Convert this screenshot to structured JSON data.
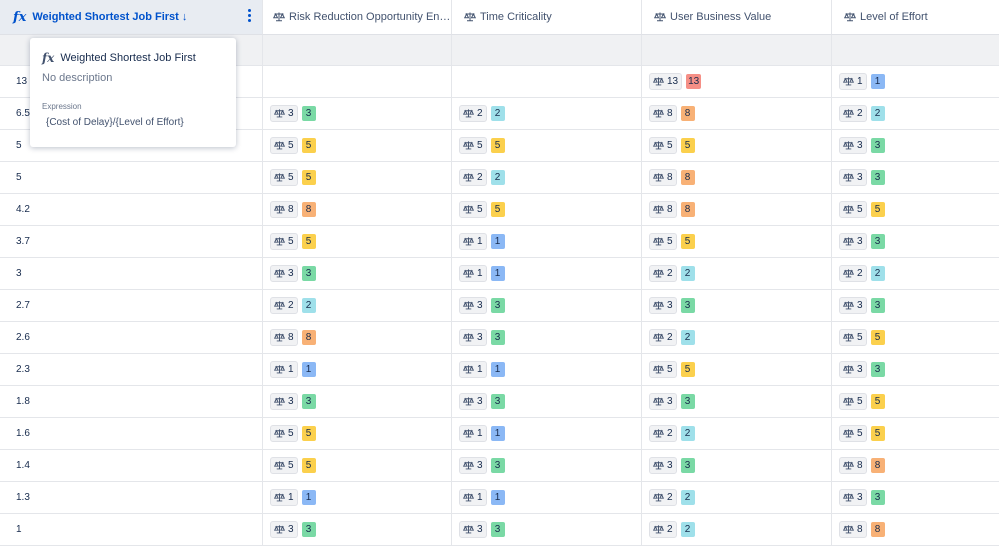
{
  "columns": [
    {
      "label": "Weighted Shortest Job First",
      "sort_icon": "↓"
    },
    {
      "label": "Risk Reduction Opportunity Enabl..."
    },
    {
      "label": "Time Criticality"
    },
    {
      "label": "User Business Value"
    },
    {
      "label": "Level of Effort"
    }
  ],
  "popover": {
    "title": "Weighted Shortest Job First",
    "description": "No description",
    "expression_label": "Expression",
    "expression": "{Cost of Delay}/{Level of Effort}"
  },
  "rows": [
    {
      "wsjf": "13",
      "vals": [
        null,
        null,
        13,
        1
      ]
    },
    {
      "wsjf": "6.5",
      "vals": [
        3,
        2,
        8,
        2
      ]
    },
    {
      "wsjf": "5",
      "vals": [
        5,
        5,
        5,
        3
      ]
    },
    {
      "wsjf": "5",
      "vals": [
        5,
        2,
        8,
        3
      ]
    },
    {
      "wsjf": "4.2",
      "vals": [
        8,
        5,
        8,
        5
      ]
    },
    {
      "wsjf": "3.7",
      "vals": [
        5,
        1,
        5,
        3
      ]
    },
    {
      "wsjf": "3",
      "vals": [
        3,
        1,
        2,
        2
      ]
    },
    {
      "wsjf": "2.7",
      "vals": [
        2,
        3,
        3,
        3
      ]
    },
    {
      "wsjf": "2.6",
      "vals": [
        8,
        3,
        2,
        5
      ]
    },
    {
      "wsjf": "2.3",
      "vals": [
        1,
        1,
        5,
        3
      ]
    },
    {
      "wsjf": "1.8",
      "vals": [
        3,
        3,
        3,
        5
      ]
    },
    {
      "wsjf": "1.6",
      "vals": [
        5,
        1,
        2,
        5
      ]
    },
    {
      "wsjf": "1.4",
      "vals": [
        5,
        3,
        3,
        8
      ]
    },
    {
      "wsjf": "1.3",
      "vals": [
        1,
        1,
        2,
        3
      ]
    },
    {
      "wsjf": "1",
      "vals": [
        3,
        3,
        2,
        8
      ]
    }
  ],
  "icons": {
    "scale": "scale-icon",
    "formula": "fx-icon",
    "menu": "more-vertical-icon"
  }
}
